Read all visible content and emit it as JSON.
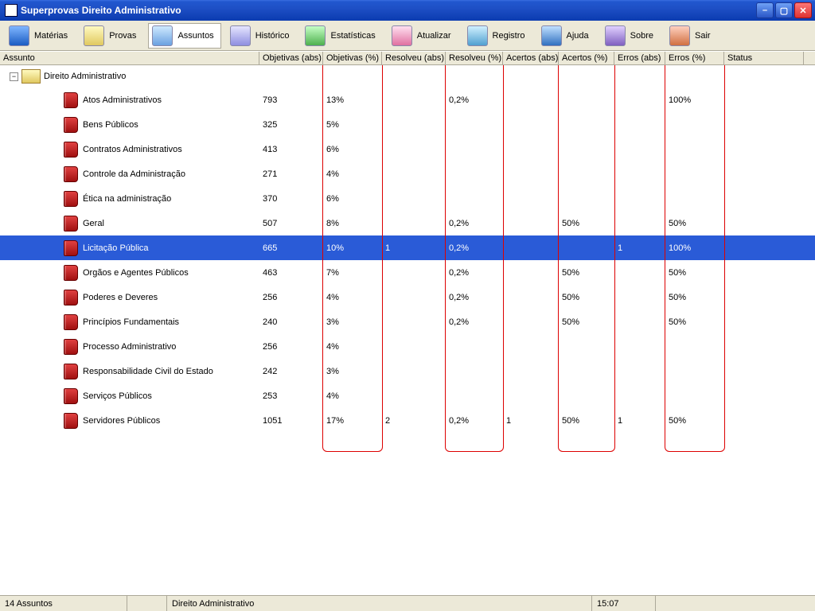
{
  "window": {
    "title": "Superprovas Direito Administrativo"
  },
  "toolbar": {
    "materias": "Matérias",
    "provas": "Provas",
    "assuntos": "Assuntos",
    "historico": "Histórico",
    "estatisticas": "Estatísticas",
    "atualizar": "Atualizar",
    "registro": "Registro",
    "ajuda": "Ajuda",
    "sobre": "Sobre",
    "sair": "Sair"
  },
  "columns": {
    "assunto": "Assunto",
    "obj_abs": "Objetivas (abs)",
    "obj_pct": "Objetivas (%)",
    "res_abs": "Resolveu (abs)",
    "res_pct": "Resolveu (%)",
    "ace_abs": "Acertos (abs)",
    "ace_pct": "Acertos (%)",
    "err_abs": "Erros (abs)",
    "err_pct": "Erros (%)",
    "status": "Status"
  },
  "root": {
    "label": "Direito Administrativo"
  },
  "rows": [
    {
      "label": "Atos Administrativos",
      "obj_abs": "793",
      "obj_pct": "13%",
      "res_abs": "",
      "res_pct": "0,2%",
      "ace_abs": "",
      "ace_pct": "",
      "err_abs": "",
      "err_pct": "100%",
      "selected": false
    },
    {
      "label": "Bens Públicos",
      "obj_abs": "325",
      "obj_pct": "5%",
      "res_abs": "",
      "res_pct": "",
      "ace_abs": "",
      "ace_pct": "",
      "err_abs": "",
      "err_pct": "",
      "selected": false
    },
    {
      "label": "Contratos Administrativos",
      "obj_abs": "413",
      "obj_pct": "6%",
      "res_abs": "",
      "res_pct": "",
      "ace_abs": "",
      "ace_pct": "",
      "err_abs": "",
      "err_pct": "",
      "selected": false
    },
    {
      "label": "Controle da Administração",
      "obj_abs": "271",
      "obj_pct": "4%",
      "res_abs": "",
      "res_pct": "",
      "ace_abs": "",
      "ace_pct": "",
      "err_abs": "",
      "err_pct": "",
      "selected": false
    },
    {
      "label": "Ética na administração",
      "obj_abs": "370",
      "obj_pct": "6%",
      "res_abs": "",
      "res_pct": "",
      "ace_abs": "",
      "ace_pct": "",
      "err_abs": "",
      "err_pct": "",
      "selected": false
    },
    {
      "label": "Geral",
      "obj_abs": "507",
      "obj_pct": "8%",
      "res_abs": "",
      "res_pct": "0,2%",
      "ace_abs": "",
      "ace_pct": "50%",
      "err_abs": "",
      "err_pct": "50%",
      "selected": false
    },
    {
      "label": "Licitação Pública",
      "obj_abs": "665",
      "obj_pct": "10%",
      "res_abs": "1",
      "res_pct": "0,2%",
      "ace_abs": "",
      "ace_pct": "",
      "err_abs": "1",
      "err_pct": "100%",
      "selected": true
    },
    {
      "label": "Orgãos e Agentes Públicos",
      "obj_abs": "463",
      "obj_pct": "7%",
      "res_abs": "",
      "res_pct": "0,2%",
      "ace_abs": "",
      "ace_pct": "50%",
      "err_abs": "",
      "err_pct": "50%",
      "selected": false
    },
    {
      "label": "Poderes e Deveres",
      "obj_abs": "256",
      "obj_pct": "4%",
      "res_abs": "",
      "res_pct": "0,2%",
      "ace_abs": "",
      "ace_pct": "50%",
      "err_abs": "",
      "err_pct": "50%",
      "selected": false
    },
    {
      "label": "Princípios Fundamentais",
      "obj_abs": "240",
      "obj_pct": "3%",
      "res_abs": "",
      "res_pct": "0,2%",
      "ace_abs": "",
      "ace_pct": "50%",
      "err_abs": "",
      "err_pct": "50%",
      "selected": false
    },
    {
      "label": "Processo Administrativo",
      "obj_abs": "256",
      "obj_pct": "4%",
      "res_abs": "",
      "res_pct": "",
      "ace_abs": "",
      "ace_pct": "",
      "err_abs": "",
      "err_pct": "",
      "selected": false
    },
    {
      "label": "Responsabilidade Civil do Estado",
      "obj_abs": "242",
      "obj_pct": "3%",
      "res_abs": "",
      "res_pct": "",
      "ace_abs": "",
      "ace_pct": "",
      "err_abs": "",
      "err_pct": "",
      "selected": false
    },
    {
      "label": "Serviços Públicos",
      "obj_abs": "253",
      "obj_pct": "4%",
      "res_abs": "",
      "res_pct": "",
      "ace_abs": "",
      "ace_pct": "",
      "err_abs": "",
      "err_pct": "",
      "selected": false
    },
    {
      "label": "Servidores Públicos",
      "obj_abs": "1051",
      "obj_pct": "17%",
      "res_abs": "2",
      "res_pct": "0,2%",
      "ace_abs": "1",
      "ace_pct": "50%",
      "err_abs": "1",
      "err_pct": "50%",
      "selected": false
    }
  ],
  "statusbar": {
    "count": "14 Assuntos",
    "subject": "Direito Administrativo",
    "time": "15:07"
  },
  "colwidths": {
    "assunto": 326,
    "obj_abs": 80,
    "obj_pct": 74,
    "res_abs": 80,
    "res_pct": 72,
    "ace_abs": 70,
    "ace_pct": 70,
    "err_abs": 64,
    "err_pct": 74,
    "status": 100
  }
}
